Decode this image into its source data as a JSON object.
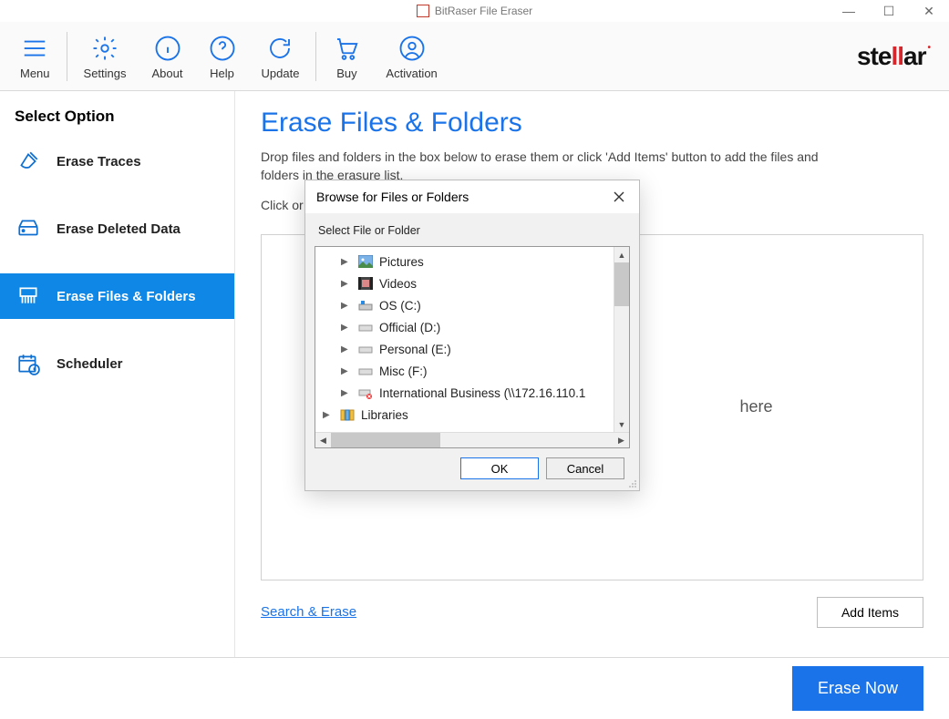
{
  "titlebar": {
    "title": "BitRaser File Eraser"
  },
  "toolbar": {
    "menu": "Menu",
    "settings": "Settings",
    "about": "About",
    "help": "Help",
    "update": "Update",
    "buy": "Buy",
    "activation": "Activation"
  },
  "brand": {
    "pre": "ste",
    "mid": "ll",
    "post": "ar"
  },
  "sidebar": {
    "title": "Select Option",
    "items": [
      {
        "label": "Erase Traces"
      },
      {
        "label": "Erase Deleted Data"
      },
      {
        "label": "Erase Files & Folders"
      },
      {
        "label": "Scheduler"
      }
    ]
  },
  "page": {
    "title": "Erase Files & Folders",
    "desc": "Drop files and folders in the box below to erase them or click 'Add Items' button to add the files and folders in the erasure list.",
    "sub_prefix": "Click or",
    "drop_hint_suffix": "here",
    "search_link": "Search & Erase",
    "add_items": "Add Items"
  },
  "footer": {
    "erase_now": "Erase Now"
  },
  "dialog": {
    "title": "Browse for Files or Folders",
    "label": "Select File or Folder",
    "ok": "OK",
    "cancel": "Cancel",
    "tree": [
      {
        "label": "Pictures",
        "type": "pictures"
      },
      {
        "label": "Videos",
        "type": "videos"
      },
      {
        "label": "OS (C:)",
        "type": "drive"
      },
      {
        "label": "Official (D:)",
        "type": "drive"
      },
      {
        "label": "Personal (E:)",
        "type": "drive"
      },
      {
        "label": "Misc (F:)",
        "type": "drive"
      },
      {
        "label": "International Business (\\\\172.16.110.1",
        "type": "netdrive"
      }
    ],
    "libraries": "Libraries"
  }
}
